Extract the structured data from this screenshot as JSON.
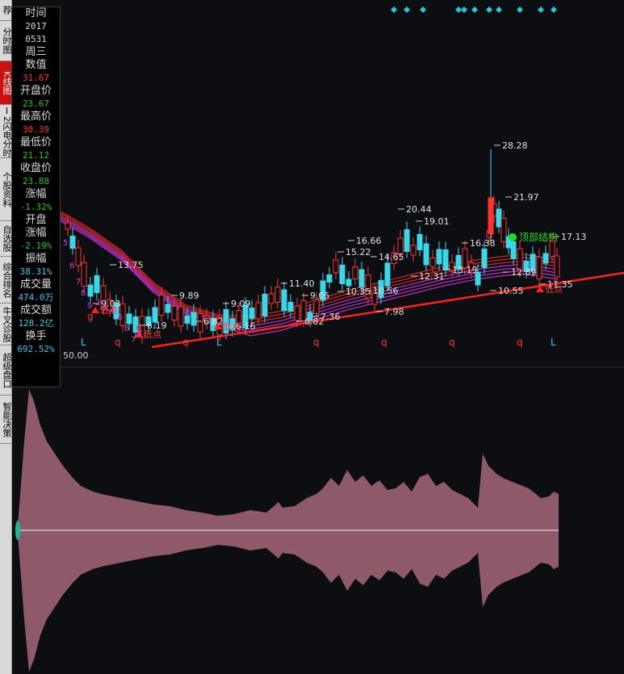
{
  "sidebar": {
    "tabs": [
      {
        "label": "荐"
      },
      {
        "label": "分时图"
      },
      {
        "label": "K线图",
        "active": true
      },
      {
        "label": "Ⅰ2闪电分时"
      },
      {
        "label": "个股资料"
      },
      {
        "label": "自选股"
      },
      {
        "label": "综合排名"
      },
      {
        "label": "牛叉诊股"
      },
      {
        "label": "超级盘口"
      },
      {
        "label": "智能决策"
      }
    ]
  },
  "info": {
    "time_label": "时间",
    "year": "2017",
    "date": "0531",
    "weekday": "周三",
    "value_label": "数值",
    "value": "31.67",
    "open_label": "开盘价",
    "open": "23.67",
    "high_label": "最高价",
    "high": "30.39",
    "low_label": "最低价",
    "low": "21.12",
    "close_label": "收盘价",
    "close": "23.88",
    "change_label": "涨幅",
    "change": "-1.32%",
    "open_change_label1": "开盘",
    "open_change_label2": "涨幅",
    "open_change": "-2.19%",
    "amplitude_label": "振幅",
    "amplitude": "38.31%",
    "volume_label": "成交量",
    "volume": "474.0万",
    "turnover_label": "成交额",
    "turnover": "128.2亿",
    "rate_label": "换手",
    "rate": "692.52%"
  },
  "chart_data": {
    "type": "candlestick",
    "y_axis_label": "50.00",
    "annotations": {
      "price_labels": [
        "28.28",
        "21.97",
        "20.44",
        "19.01",
        "16.66",
        "16.38",
        "17.13",
        "15.22",
        "14.65",
        "13.75",
        "13.19",
        "12.31",
        "12.89",
        "11.40",
        "10.55",
        "11.35",
        "10.56",
        "10.35",
        "9.89",
        "9.09",
        "9.03",
        "9.05",
        "7.98",
        "7.36",
        "6.82",
        "6.19",
        "6.16",
        "6.82"
      ],
      "signal_labels": [
        "顶部结构"
      ],
      "low_markers": [
        "低点",
        "低点",
        "低点",
        "低点"
      ],
      "bottom_marks": [
        "L",
        "q",
        "q",
        "L",
        "q",
        "q",
        "q",
        "q",
        "L"
      ],
      "red_g_marks": [
        "g",
        "g"
      ],
      "count_marks": [
        "5",
        "6",
        "7",
        "8",
        "9",
        "2",
        "3",
        "4",
        "5",
        "6",
        "7",
        "8"
      ]
    },
    "colors": {
      "up": "#ff3232",
      "down": "#38d8e8",
      "ma": "#cc33cc",
      "trend": "#ff2020",
      "oscillator": "#8e5a6a",
      "signal": "#22dd22"
    }
  }
}
